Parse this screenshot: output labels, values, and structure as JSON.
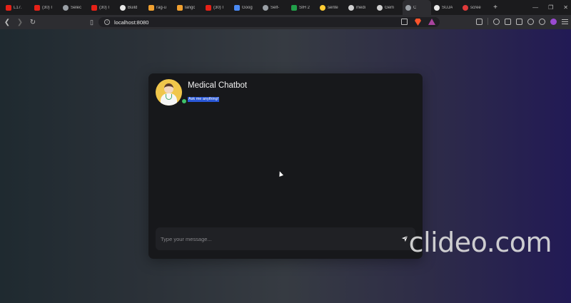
{
  "browser": {
    "tabs": [
      {
        "label": "L17.",
        "icon": "youtube-icon",
        "color": "#e62117"
      },
      {
        "label": "(30) I",
        "icon": "youtube-icon",
        "color": "#e62117"
      },
      {
        "label": "Selec",
        "icon": "globe-icon",
        "color": "#9aa0a6"
      },
      {
        "label": "(30) I",
        "icon": "youtube-icon",
        "color": "#e62117"
      },
      {
        "label": "Build",
        "icon": "github-icon",
        "color": "#e8e8e8"
      },
      {
        "label": "rag-u",
        "icon": "langchain-icon",
        "color": "#f0a030"
      },
      {
        "label": "langc",
        "icon": "langchain-icon",
        "color": "#f0a030"
      },
      {
        "label": "(30) I",
        "icon": "youtube-icon",
        "color": "#e62117"
      },
      {
        "label": "Goog",
        "icon": "gemini-icon",
        "color": "#4a8af4"
      },
      {
        "label": "Self-",
        "icon": "globe-icon",
        "color": "#9aa0a6"
      },
      {
        "label": "SIH 2",
        "icon": "sih-icon",
        "color": "#22a04a"
      },
      {
        "label": "sente",
        "icon": "huggingface-icon",
        "color": "#ffcc33"
      },
      {
        "label": "medi",
        "icon": "openai-icon",
        "color": "#d0d0d0"
      },
      {
        "label": "Gem",
        "icon": "google-icon",
        "color": "#d0d0d0"
      },
      {
        "label": "C",
        "icon": "globe-icon",
        "color": "#9aa0a6",
        "active": true
      },
      {
        "label": "SUJA",
        "icon": "github-icon",
        "color": "#e8e8e8"
      },
      {
        "label": "scree",
        "icon": "record-icon",
        "color": "#e03a3a"
      }
    ],
    "new_tab": "+",
    "url": "localhost:8080"
  },
  "chat": {
    "title": "Medical Chatbot",
    "subtitle": "Ask me anything!",
    "input_placeholder": "Type your message...",
    "status": "online"
  },
  "watermark": "clideo.com",
  "colors": {
    "card_bg": "#17181b",
    "avatar_bg": "#f0c64b",
    "online": "#3ec26a",
    "subtitle_highlight": "#2957d6"
  }
}
